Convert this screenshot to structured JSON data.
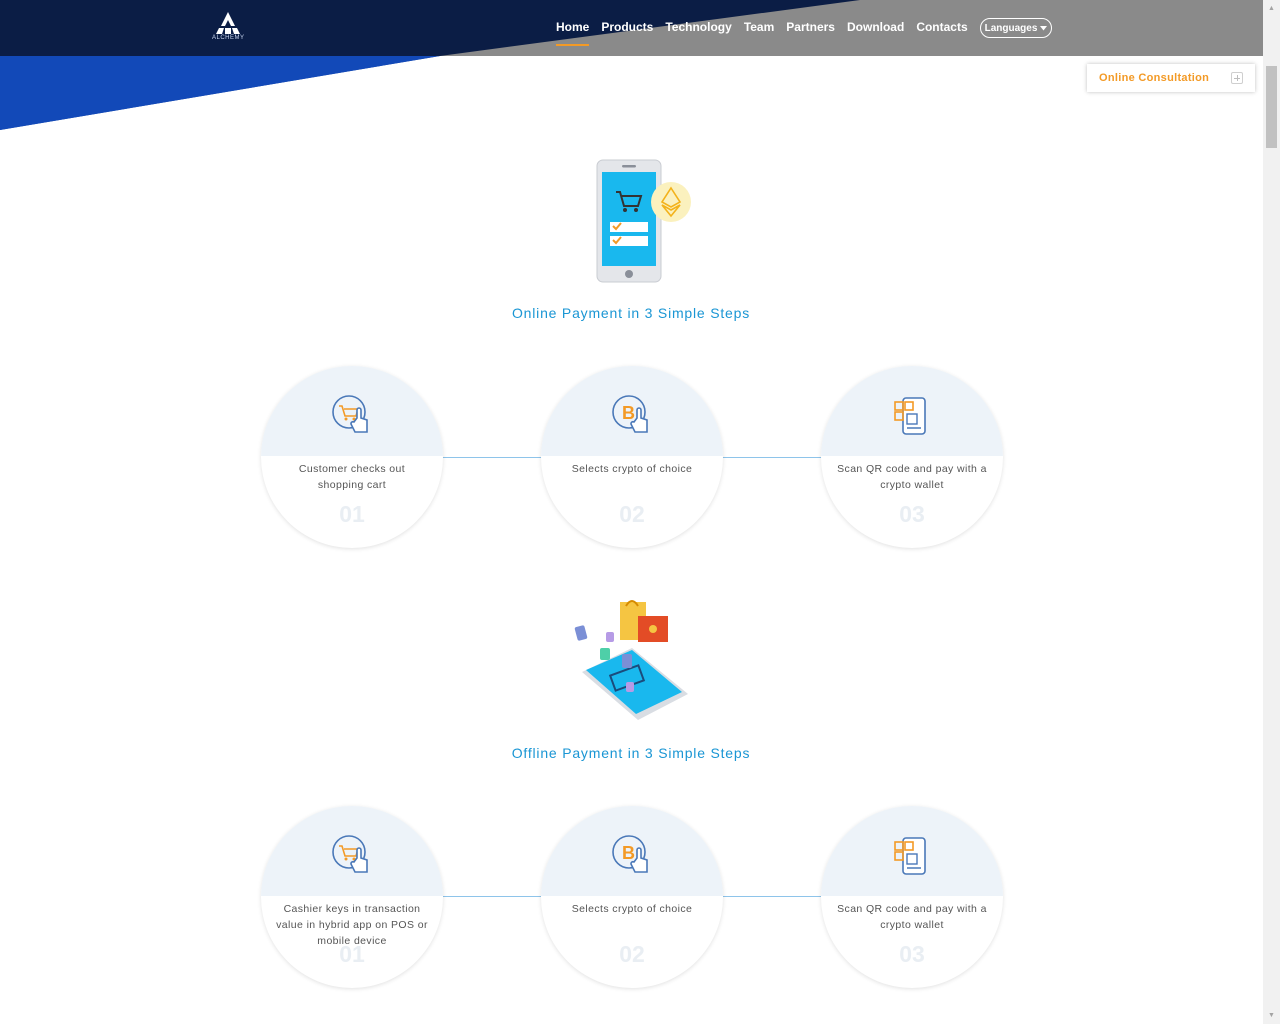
{
  "header": {
    "logo_text": "ALCHEMY",
    "nav": [
      {
        "label": "Home",
        "active": true
      },
      {
        "label": "Products"
      },
      {
        "label": "Technology"
      },
      {
        "label": "Team"
      },
      {
        "label": "Partners"
      },
      {
        "label": "Download"
      },
      {
        "label": "Contacts"
      }
    ],
    "languages_label": "Languages"
  },
  "consultation": {
    "label": "Online Consultation"
  },
  "online": {
    "title": "Online Payment in 3 Simple Steps",
    "steps": [
      {
        "text": "Customer checks out shopping cart",
        "num": "01",
        "icon": "cart-hand-icon"
      },
      {
        "text": "Selects crypto of choice",
        "num": "02",
        "icon": "bitcoin-hand-icon"
      },
      {
        "text": "Scan QR code and pay with a crypto wallet",
        "num": "03",
        "icon": "qr-phone-icon"
      }
    ]
  },
  "offline": {
    "title": "Offline Payment in 3 Simple Steps",
    "steps": [
      {
        "text": "Cashier keys in transaction value in hybrid app on POS or mobile device",
        "num": "01",
        "icon": "cart-hand-icon"
      },
      {
        "text": "Selects crypto of choice",
        "num": "02",
        "icon": "bitcoin-hand-icon"
      },
      {
        "text": "Scan QR code and pay with a crypto wallet",
        "num": "03",
        "icon": "qr-phone-icon"
      }
    ]
  },
  "colors": {
    "accent": "#f39a26",
    "title_blue": "#1a96d4",
    "header_dark": "#0b1d45",
    "header_grey": "#8a8a8a"
  }
}
